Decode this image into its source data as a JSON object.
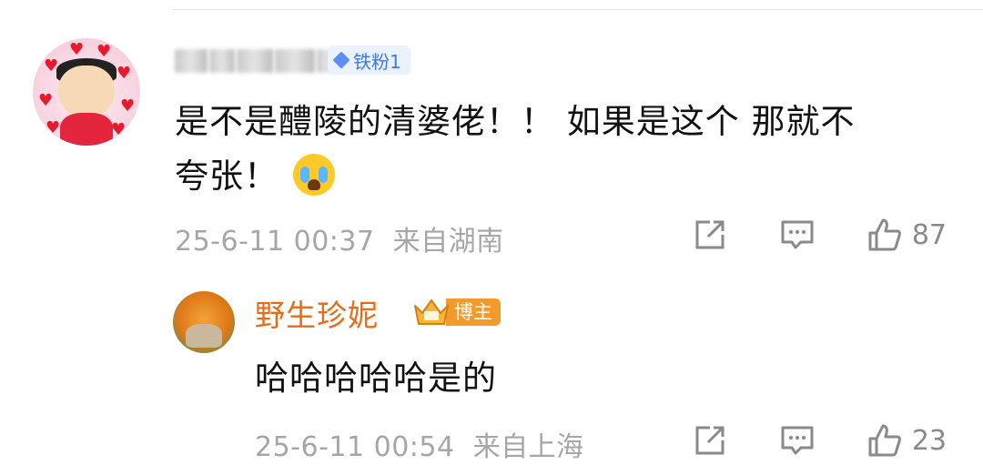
{
  "comment": {
    "badge": "铁粉1",
    "text_line1": "是不是醴陵的清婆佬！！ 如果是这个 那就不",
    "text_line2": "夸张！",
    "timestamp": "25-6-11 00:37",
    "location": "来自湖南",
    "likes": "87"
  },
  "reply": {
    "username": "野生珍妮",
    "badge": "博主",
    "text": "哈哈哈哈哈是的",
    "timestamp": "25-6-11 00:54",
    "location": "来自上海",
    "likes": "23"
  },
  "colors": {
    "meta_gray": "#a6a6a6",
    "reply_name": "#e46c1a",
    "host_badge": "#f29a2e",
    "fan_badge_bg": "#eaf1ff",
    "fan_badge_text": "#3f78e8"
  }
}
